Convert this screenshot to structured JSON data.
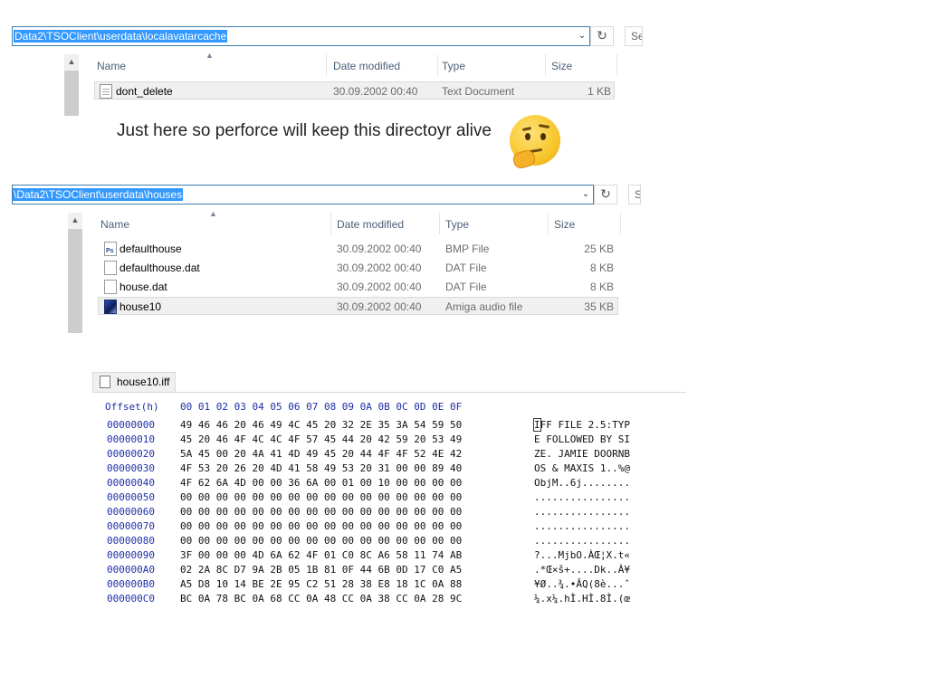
{
  "explorer1": {
    "address": "Data2\\TSOClient\\userdata\\localavatarcache",
    "search_placeholder": "Se",
    "columns": {
      "name": "Name",
      "date": "Date modified",
      "type": "Type",
      "size": "Size"
    },
    "files": [
      {
        "name": "dont_delete",
        "date": "30.09.2002 00:40",
        "type": "Text Document",
        "size": "1 KB",
        "icon": "text-document-icon"
      }
    ]
  },
  "comment": "Just here so perforce will keep this directoyr alive",
  "emoji": "thinking-face-icon",
  "explorer2": {
    "address": "\\Data2\\TSOClient\\userdata\\houses",
    "search_placeholder": "S",
    "columns": {
      "name": "Name",
      "date": "Date modified",
      "type": "Type",
      "size": "Size"
    },
    "files": [
      {
        "name": "defaulthouse",
        "date": "30.09.2002 00:40",
        "type": "BMP File",
        "size": "25 KB",
        "icon": "photoshop-file-icon"
      },
      {
        "name": "defaulthouse.dat",
        "date": "30.09.2002 00:40",
        "type": "DAT File",
        "size": "8 KB",
        "icon": "blank-file-icon"
      },
      {
        "name": "house.dat",
        "date": "30.09.2002 00:40",
        "type": "DAT File",
        "size": "8 KB",
        "icon": "blank-file-icon"
      },
      {
        "name": "house10",
        "date": "30.09.2002 00:40",
        "type": "Amiga audio file",
        "size": "35 KB",
        "icon": "amiga-audio-icon"
      }
    ]
  },
  "hexeditor": {
    "tab": "house10.iff",
    "header_offset": "Offset(h)",
    "header_columns": "00 01 02 03 04 05 06 07 08 09 0A 0B 0C 0D 0E 0F",
    "rows": [
      {
        "offset": "00000000",
        "bytes": "49 46 46 20 46 49 4C 45 20 32 2E 35 3A 54 59 50",
        "ascii_first": "I",
        "ascii": "FF FILE 2.5:TYP"
      },
      {
        "offset": "00000010",
        "bytes": "45 20 46 4F 4C 4C 4F 57 45 44 20 42 59 20 53 49",
        "ascii_first": "",
        "ascii": "E FOLLOWED BY SI"
      },
      {
        "offset": "00000020",
        "bytes": "5A 45 00 20 4A 41 4D 49 45 20 44 4F 4F 52 4E 42",
        "ascii_first": "",
        "ascii": "ZE. JAMIE DOORNB"
      },
      {
        "offset": "00000030",
        "bytes": "4F 53 20 26 20 4D 41 58 49 53 20 31 00 00 89 40",
        "ascii_first": "",
        "ascii": "OS & MAXIS 1..%@"
      },
      {
        "offset": "00000040",
        "bytes": "4F 62 6A 4D 00 00 36 6A 00 01 00 10 00 00 00 00",
        "ascii_first": "",
        "ascii": "ObjM..6j........"
      },
      {
        "offset": "00000050",
        "bytes": "00 00 00 00 00 00 00 00 00 00 00 00 00 00 00 00",
        "ascii_first": "",
        "ascii": "................"
      },
      {
        "offset": "00000060",
        "bytes": "00 00 00 00 00 00 00 00 00 00 00 00 00 00 00 00",
        "ascii_first": "",
        "ascii": "................"
      },
      {
        "offset": "00000070",
        "bytes": "00 00 00 00 00 00 00 00 00 00 00 00 00 00 00 00",
        "ascii_first": "",
        "ascii": "................"
      },
      {
        "offset": "00000080",
        "bytes": "00 00 00 00 00 00 00 00 00 00 00 00 00 00 00 00",
        "ascii_first": "",
        "ascii": "................"
      },
      {
        "offset": "00000090",
        "bytes": "3F 00 00 00 4D 6A 62 4F 01 C0 8C A6 58 11 74 AB",
        "ascii_first": "",
        "ascii": "?...MjbO.ÀŒ¦X.t«"
      },
      {
        "offset": "000000A0",
        "bytes": "02 2A 8C D7 9A 2B 05 1B 81 0F 44 6B 0D 17 C0 A5",
        "ascii_first": "",
        "ascii": ".*Œ×š+....Dk..À¥"
      },
      {
        "offset": "000000B0",
        "bytes": "A5 D8 10 14 BE 2E 95 C2 51 28 38 E8 18 1C 0A 88",
        "ascii_first": "",
        "ascii": "¥Ø..¾.•ÂQ(8è...ˆ"
      },
      {
        "offset": "000000C0",
        "bytes": "BC 0A 78 BC 0A 68 CC 0A 48 CC 0A 38 CC 0A 28 9C",
        "ascii_first": "",
        "ascii": "¼.x¼.hÌ.HÌ.8Ì.(œ"
      }
    ]
  }
}
